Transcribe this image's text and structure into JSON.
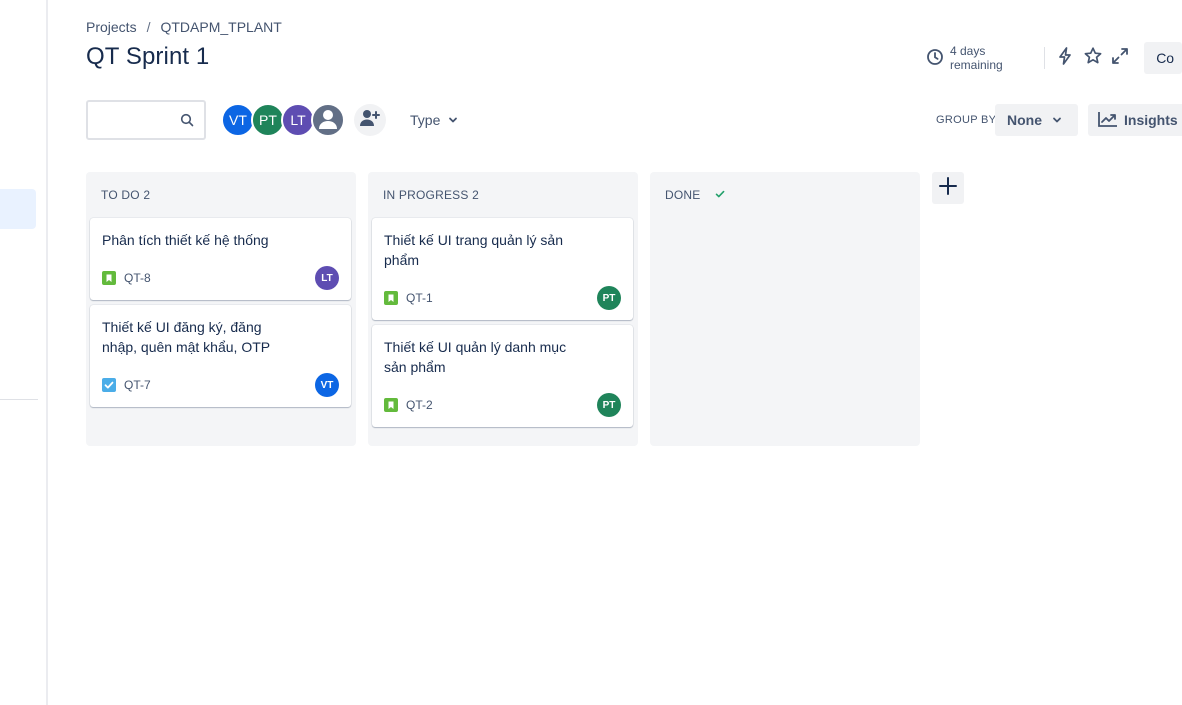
{
  "breadcrumb": {
    "items": [
      "Projects",
      "QTDAPM_TPLANT"
    ],
    "separator": "/"
  },
  "page_title": "QT Sprint 1",
  "header": {
    "remaining": "4 days remaining",
    "complete_button": "Co",
    "icons": [
      "clock-icon",
      "lightning-icon",
      "star-icon",
      "expand-icon"
    ]
  },
  "toolbar": {
    "search_value": "",
    "avatars": [
      {
        "initials": "VT",
        "color": "#0c66e4"
      },
      {
        "initials": "PT",
        "color": "#1f845a"
      },
      {
        "initials": "LT",
        "color": "#5e4db2"
      },
      {
        "initials": "",
        "color": "#626f86"
      }
    ],
    "type_filter": "Type",
    "group_by_label": "GROUP BY",
    "group_by_value": "None",
    "insights_label": "Insights"
  },
  "columns": [
    {
      "header": "TO DO 2",
      "cards": [
        {
          "title": "Phân tích thiết kế hệ thống",
          "key": "QT-8",
          "type": "story",
          "assignee": "LT",
          "assignee_color": "#5e4db2"
        },
        {
          "title": "Thiết kế UI đăng ký, đăng nhập, quên mật khẩu, OTP",
          "key": "QT-7",
          "type": "task",
          "assignee": "VT",
          "assignee_color": "#0c66e4"
        }
      ]
    },
    {
      "header": "IN PROGRESS 2",
      "cards": [
        {
          "title": "Thiết kế UI trang quản lý sản phẩm",
          "key": "QT-1",
          "type": "story",
          "assignee": "PT",
          "assignee_color": "#1f845a"
        },
        {
          "title": "Thiết kế UI quản lý danh mục sản phẩm",
          "key": "QT-2",
          "type": "story",
          "assignee": "PT",
          "assignee_color": "#1f845a"
        }
      ]
    },
    {
      "header": "DONE",
      "cards": []
    }
  ],
  "colors": {
    "story": "#63ba3c",
    "task": "#4bade8",
    "done_check": "#22a06b"
  }
}
